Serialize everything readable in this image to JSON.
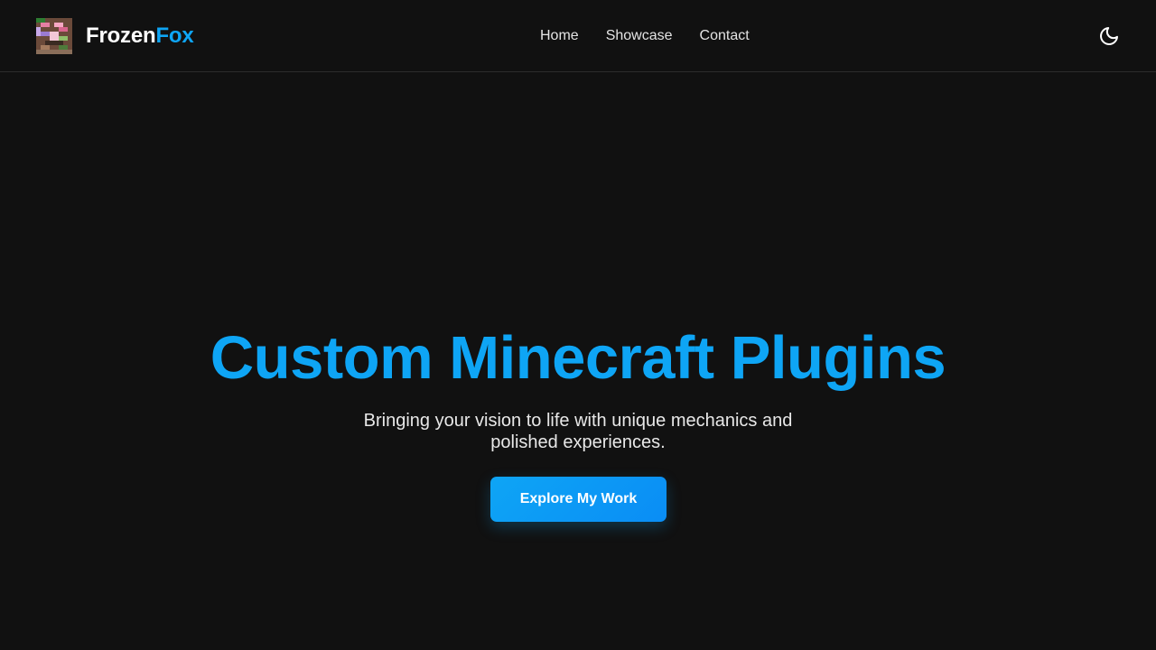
{
  "nav": {
    "brand_primary": "Frozen",
    "brand_accent": "Fox",
    "links": [
      {
        "label": "Home"
      },
      {
        "label": "Showcase"
      },
      {
        "label": "Contact"
      }
    ],
    "theme_toggle_icon": "moon-icon"
  },
  "hero": {
    "title": "Custom Minecraft Plugins",
    "subtitle": "Bringing your vision to life with unique mechanics and polished experiences.",
    "cta_label": "Explore My Work"
  },
  "colors": {
    "background": "#111111",
    "accent": "#0ea5f5",
    "text": "#e8e8e8"
  }
}
